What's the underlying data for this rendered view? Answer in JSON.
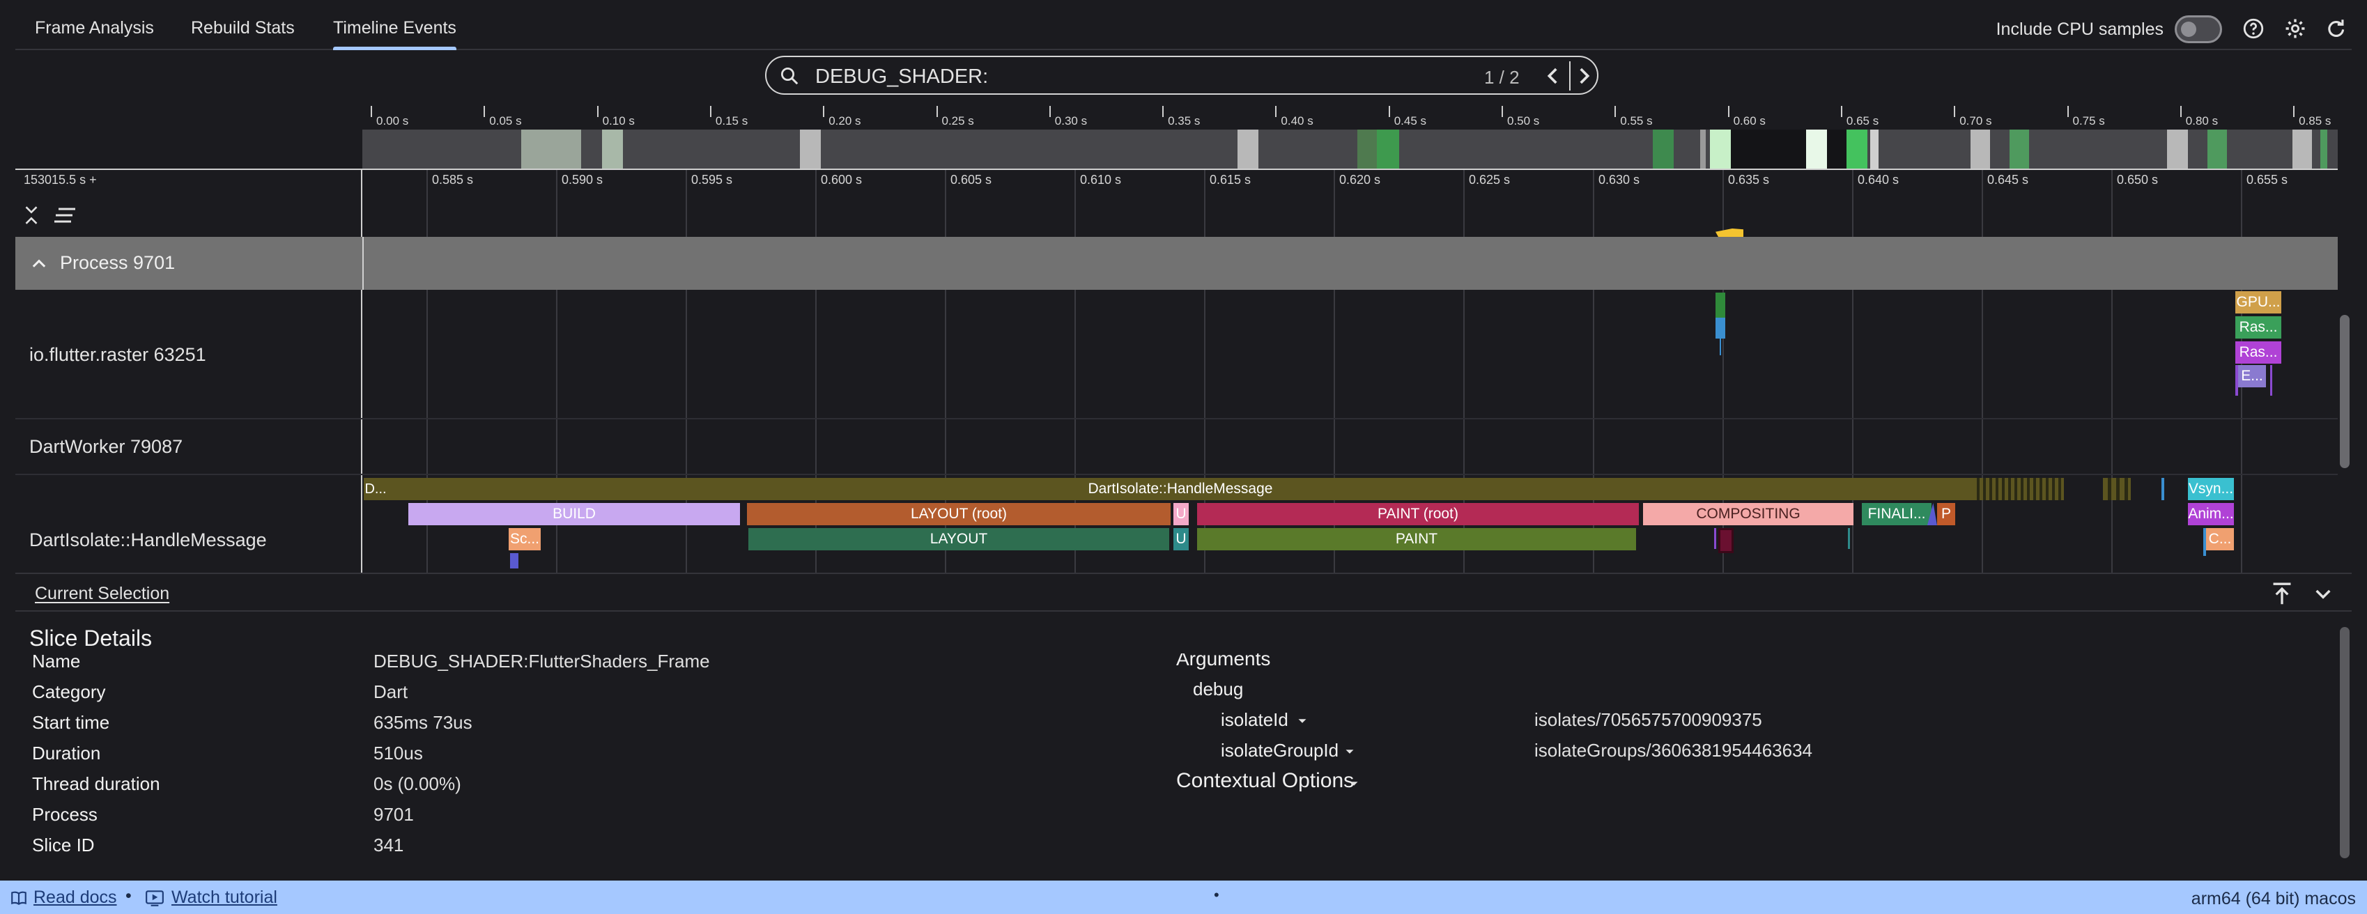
{
  "tabs": [
    {
      "label": "Frame Analysis"
    },
    {
      "label": "Rebuild Stats"
    },
    {
      "label": "Timeline Events"
    }
  ],
  "top_controls": {
    "cpu_samples_label": "Include CPU samples",
    "cpu_samples_enabled": false,
    "icons": [
      "help-icon",
      "settings-gear-icon",
      "refresh-icon"
    ]
  },
  "search": {
    "query": "DEBUG_SHADER:",
    "match_count": "1 / 2"
  },
  "overview": {
    "tick_labels": [
      "0.00 s",
      "0.05 s",
      "0.10 s",
      "0.15 s",
      "0.20 s",
      "0.25 s",
      "0.30 s",
      "0.35 s",
      "0.40 s",
      "0.45 s",
      "0.50 s",
      "0.55 s",
      "0.60 s",
      "0.65 s",
      "0.70 s",
      "0.75 s",
      "0.80 s",
      "0.85 s"
    ]
  },
  "timeline": {
    "base_time": "153015.5 s +",
    "tick_labels": [
      "0.585 s",
      "0.590 s",
      "0.595 s",
      "0.600 s",
      "0.605 s",
      "0.610 s",
      "0.615 s",
      "0.620 s",
      "0.625 s",
      "0.630 s",
      "0.635 s",
      "0.640 s",
      "0.645 s",
      "0.650 s",
      "0.655 s"
    ],
    "process_label": "Process 9701",
    "tracks": [
      {
        "label": "io.flutter.raster 63251"
      },
      {
        "label": "DartWorker 79087"
      },
      {
        "label": "DartIsolate::HandleMessage"
      }
    ],
    "raster_slices": [
      "GPU...",
      "Ras...",
      "Ras...",
      "E..."
    ],
    "isolate_slices": {
      "d_prefix": "D...",
      "handle_message": "DartIsolate::HandleMessage",
      "build": "BUILD",
      "sc": "Sc...",
      "layout_root": "LAYOUT (root)",
      "layout": "LAYOUT",
      "u1": "U",
      "u2": "U",
      "paint_root": "PAINT (root)",
      "paint": "PAINT",
      "compositing": "COMPOSITING",
      "finali": "FINALI...",
      "p": "P",
      "vsync": "Vsyn...",
      "anim": "Anim...",
      "c": "C..."
    }
  },
  "details": {
    "tab_label": "Current Selection",
    "title": "Slice Details",
    "fields": [
      {
        "key": "Name",
        "value": "DEBUG_SHADER:FlutterShaders_Frame"
      },
      {
        "key": "Category",
        "value": "Dart"
      },
      {
        "key": "Start time",
        "value": "635ms 73us"
      },
      {
        "key": "Duration",
        "value": "510us"
      },
      {
        "key": "Thread duration",
        "value": "0s (0.00%)"
      },
      {
        "key": "Process",
        "value": "9701"
      },
      {
        "key": "Slice ID",
        "value": "341"
      }
    ],
    "arguments": {
      "heading": "Arguments",
      "group": "debug",
      "items": [
        {
          "key": "isolateId",
          "value": "isolates/7056575700909375"
        },
        {
          "key": "isolateGroupId",
          "value": "isolateGroups/3606381954463634"
        }
      ],
      "contextual_options": "Contextual Options"
    }
  },
  "footer": {
    "read_docs": "Read docs",
    "separator": "•",
    "watch_tutorial": "Watch tutorial",
    "center_dot": "•",
    "platform": "arm64 (64 bit) macos"
  },
  "colors": {
    "accent": "#a5c8ff",
    "build": "#c8a8f0",
    "layout_root": "#b35c2e",
    "layout": "#2e6e50",
    "paint_root": "#b42a55",
    "paint": "#5a7a2a",
    "compositing": "#f4a9a8",
    "handle_message": "#5c5520",
    "finali": "#2f8a5e",
    "gpu": "#d0a04a",
    "raster": "#3aa05a",
    "raster2": "#b042d6"
  }
}
